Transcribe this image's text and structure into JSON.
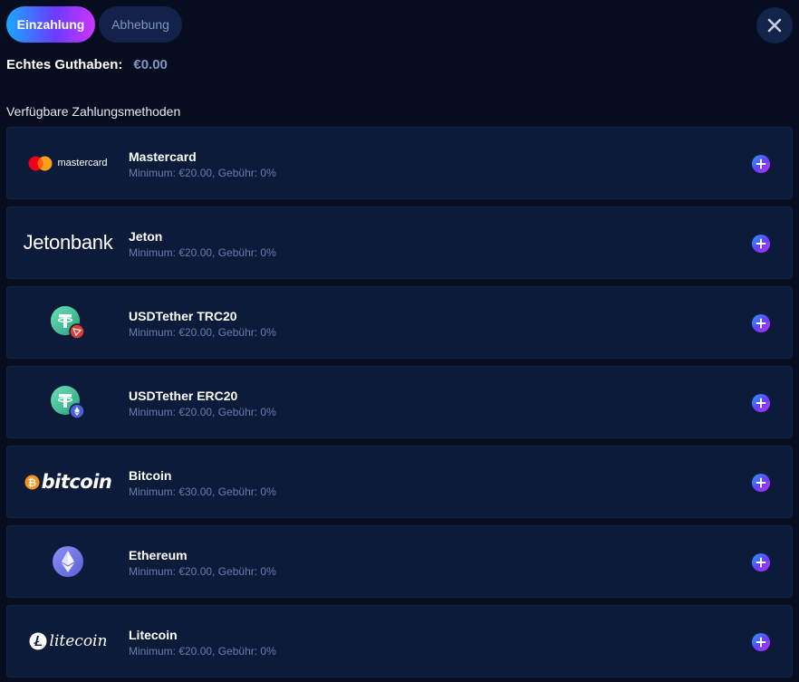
{
  "tabs": {
    "deposit_label": "Einzahlung",
    "withdraw_label": "Abhebung"
  },
  "balance": {
    "label": "Echtes Guthaben:",
    "value": "€0.00"
  },
  "section_title": "Verfügbare Zahlungsmethoden",
  "methods": [
    {
      "name": "Mastercard",
      "info": "Minimum: €20.00, Gebühr: 0%",
      "logo_text": "mastercard",
      "icon": "mastercard-logo-icon"
    },
    {
      "name": "Jeton",
      "info": "Minimum: €20.00, Gebühr: 0%",
      "logo_text": "Jetonbank",
      "icon": "jetonbank-logo"
    },
    {
      "name": "USDTether TRC20",
      "info": "Minimum: €20.00, Gebühr: 0%",
      "icon": "tether-trc20-icon"
    },
    {
      "name": "USDTether ERC20",
      "info": "Minimum: €20.00, Gebühr: 0%",
      "icon": "tether-erc20-icon"
    },
    {
      "name": "Bitcoin",
      "info": "Minimum: €30.00, Gebühr: 0%",
      "logo_text": "bitcoin",
      "icon": "bitcoin-logo-icon"
    },
    {
      "name": "Ethereum",
      "info": "Minimum: €20.00, Gebühr: 0%",
      "icon": "ethereum-icon"
    },
    {
      "name": "Litecoin",
      "info": "Minimum: €20.00, Gebühr: 0%",
      "logo_text": "litecoin",
      "icon": "litecoin-logo-icon"
    }
  ],
  "colors": {
    "background": "#050d1f",
    "card": "#0c1b3a",
    "muted_text": "#6b7ba8",
    "accent_gradient": [
      "#1aa8ff",
      "#6a3bff",
      "#d233ff"
    ]
  }
}
